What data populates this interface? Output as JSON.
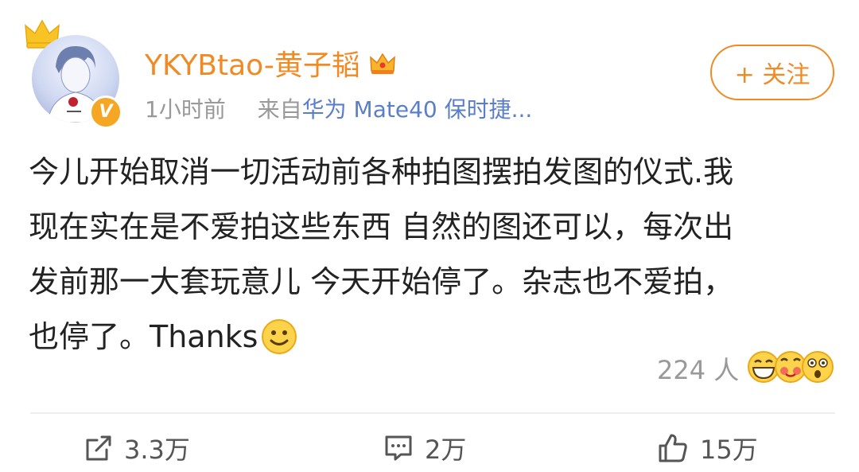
{
  "user": {
    "name": "YKYBtao-黄子韬",
    "time": "1小时前",
    "source_prefix": "来自",
    "source": "华为 Mate40 保时捷...",
    "follow_label": "+ 关注",
    "verified_icon": "v-badge-icon",
    "crown_icon": "crown-icon"
  },
  "post": {
    "lines": [
      "今儿开始取消一切活动前各种拍图摆拍发图的仪式.我",
      "现在实在是不爱拍这些东西 自然的图还可以，每次出",
      "发前那一大套玩意儿 今天开始停了。杂志也不爱拍，",
      "也停了。Thanks"
    ]
  },
  "reactions": {
    "count": "224 人",
    "icons": [
      "grin-emoji-icon",
      "love-emoji-icon",
      "surprised-emoji-icon"
    ]
  },
  "actions": {
    "repost": "3.3万",
    "comment": "2万",
    "like": "15万"
  },
  "colors": {
    "accent": "#f08a24",
    "link": "#5b7ec9",
    "text": "#222222",
    "muted": "#999999"
  }
}
